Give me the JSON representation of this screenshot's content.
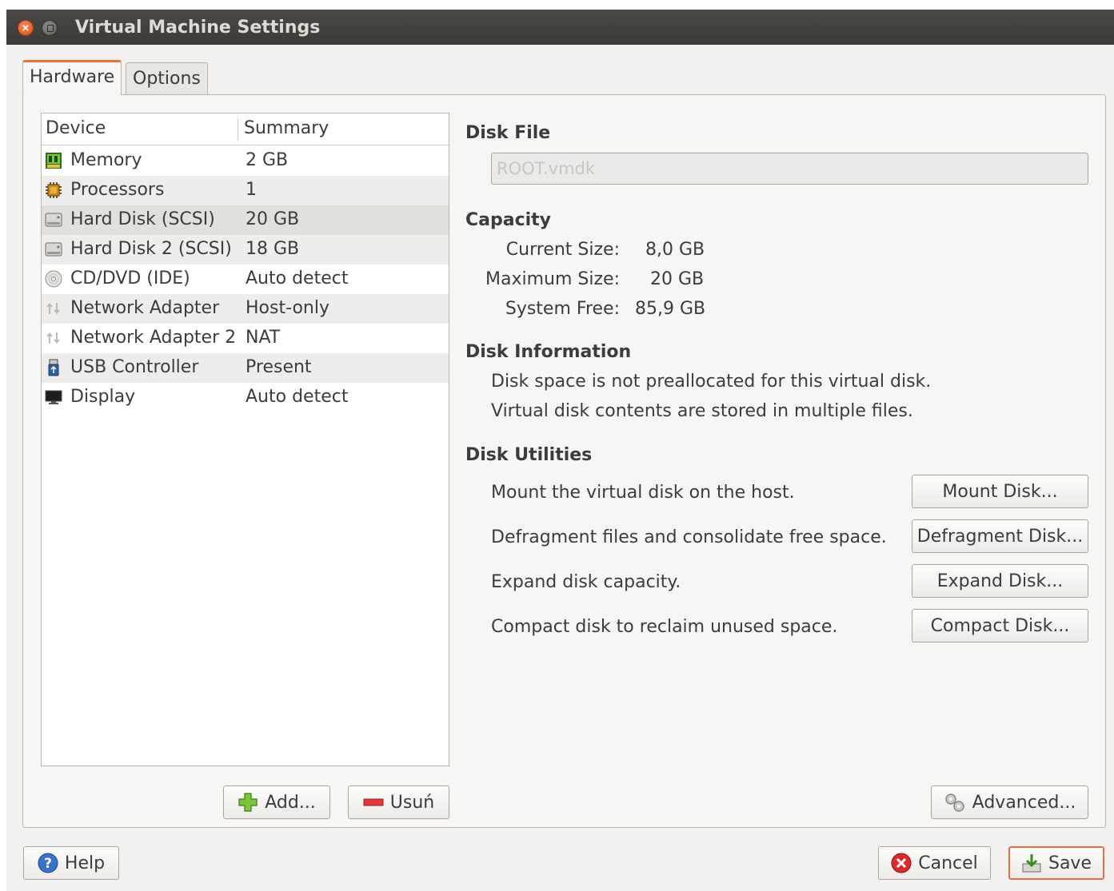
{
  "window": {
    "title": "Virtual Machine Settings",
    "close_glyph": "×"
  },
  "tabs": [
    {
      "label": "Hardware",
      "active": true
    },
    {
      "label": "Options",
      "active": false
    }
  ],
  "device_list": {
    "columns": {
      "device": "Device",
      "summary": "Summary"
    },
    "rows": [
      {
        "icon": "memory-icon",
        "name": "Memory",
        "summary": "2 GB"
      },
      {
        "icon": "processor-icon",
        "name": "Processors",
        "summary": "1"
      },
      {
        "icon": "hard-disk-icon",
        "name": "Hard Disk (SCSI)",
        "summary": "20 GB",
        "selected": true
      },
      {
        "icon": "hard-disk-icon",
        "name": "Hard Disk 2 (SCSI)",
        "summary": "18 GB"
      },
      {
        "icon": "cd-dvd-icon",
        "name": "CD/DVD (IDE)",
        "summary": "Auto detect"
      },
      {
        "icon": "network-adapter-icon",
        "name": "Network Adapter",
        "summary": "Host-only"
      },
      {
        "icon": "network-adapter-icon",
        "name": "Network Adapter 2",
        "summary": "NAT"
      },
      {
        "icon": "usb-icon",
        "name": "USB Controller",
        "summary": "Present"
      },
      {
        "icon": "display-icon",
        "name": "Display",
        "summary": "Auto detect"
      }
    ]
  },
  "list_buttons": {
    "add": "Add...",
    "remove": "Usuń"
  },
  "disk_file": {
    "heading": "Disk File",
    "value": "ROOT.vmdk"
  },
  "capacity": {
    "heading": "Capacity",
    "current_label": "Current Size:",
    "current_value": "8,0 GB",
    "maximum_label": "Maximum Size:",
    "maximum_value": "20 GB",
    "free_label": "System Free:",
    "free_value": "85,9 GB"
  },
  "disk_information": {
    "heading": "Disk Information",
    "line1": "Disk space is not preallocated for this virtual disk.",
    "line2": "Virtual disk contents are stored in multiple files."
  },
  "disk_utilities": {
    "heading": "Disk Utilities",
    "items": [
      {
        "description": "Mount the virtual disk on the host.",
        "button": "Mount Disk..."
      },
      {
        "description": "Defragment files and consolidate free space.",
        "button": "Defragment Disk..."
      },
      {
        "description": "Expand disk capacity.",
        "button": "Expand Disk..."
      },
      {
        "description": "Compact disk to reclaim unused space.",
        "button": "Compact Disk..."
      }
    ]
  },
  "advanced_button": "Advanced...",
  "footer": {
    "help": "Help",
    "cancel": "Cancel",
    "save": "Save"
  },
  "colors": {
    "accent": "#e8713d",
    "titlebar": "#3b3a36",
    "background": "#f2f1f0"
  }
}
